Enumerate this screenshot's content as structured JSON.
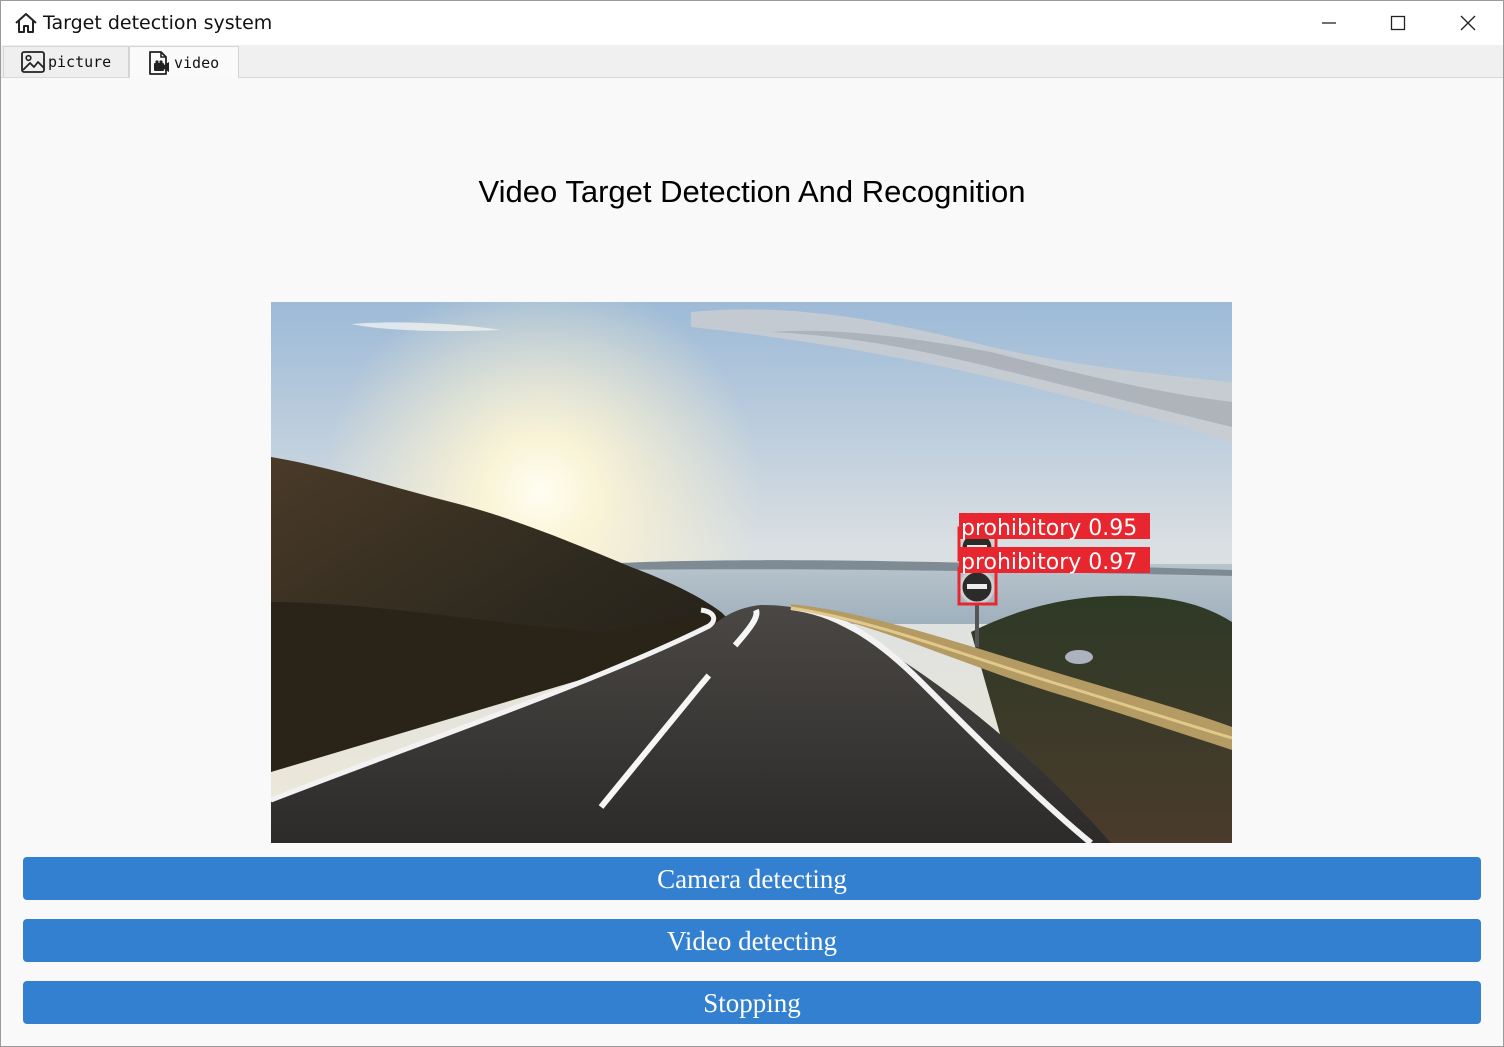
{
  "window": {
    "title": "Target detection system"
  },
  "tabs": [
    {
      "label": "picture",
      "icon": "image-icon",
      "active": false
    },
    {
      "label": "video",
      "icon": "video-file-icon",
      "active": true
    }
  ],
  "main": {
    "heading": "Video Target Detection And Recognition",
    "detections": [
      {
        "label": "prohibitory 0.95",
        "class": "prohibitory",
        "confidence": 0.95
      },
      {
        "label": "prohibitory 0.97",
        "class": "prohibitory",
        "confidence": 0.97
      }
    ],
    "detection_color": "#e8262f"
  },
  "buttons": {
    "camera": "Camera detecting",
    "video": "Video detecting",
    "stop": "Stopping"
  },
  "colors": {
    "button_bg": "#337fd0",
    "button_text": "#ffffff"
  }
}
